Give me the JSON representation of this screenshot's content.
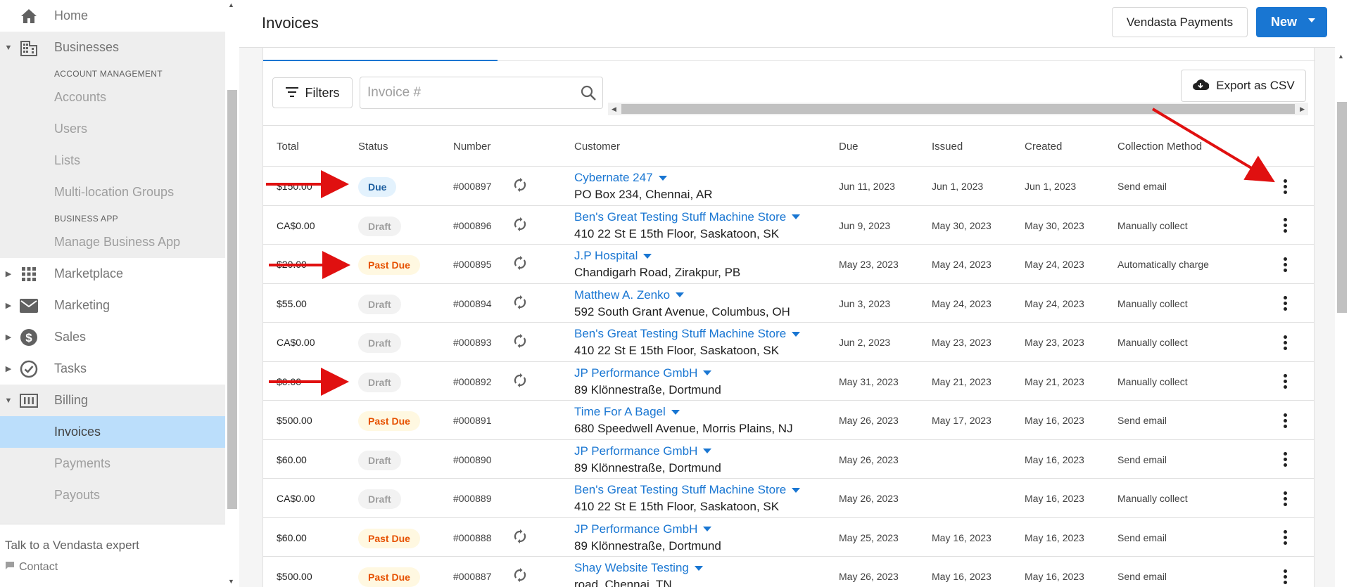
{
  "sidebar": {
    "home": "Home",
    "businesses": "Businesses",
    "account_management_header": "ACCOUNT MANAGEMENT",
    "account_items": [
      "Accounts",
      "Users",
      "Lists",
      "Multi-location Groups"
    ],
    "business_app_header": "BUSINESS APP",
    "manage_business_app": "Manage Business App",
    "marketplace": "Marketplace",
    "marketing": "Marketing",
    "sales": "Sales",
    "tasks": "Tasks",
    "billing": "Billing",
    "billing_items": [
      "Invoices",
      "Payments",
      "Payouts"
    ],
    "talk": "Talk to a Vendasta expert",
    "contact": "Contact"
  },
  "header": {
    "title": "Invoices",
    "vendasta_payments": "Vendasta Payments",
    "new": "New"
  },
  "toolbar": {
    "filters": "Filters",
    "search_placeholder": "Invoice #",
    "export": "Export as CSV"
  },
  "table": {
    "columns": [
      "Total",
      "Status",
      "Number",
      "Customer",
      "Due",
      "Issued",
      "Created",
      "Collection Method"
    ],
    "rows": [
      {
        "total": "$150.00",
        "status": "Due",
        "number": "#000897",
        "recurring": true,
        "customer": "Cybernate 247",
        "address": "PO Box 234, Chennai, AR",
        "due": "Jun 11, 2023",
        "issued": "Jun 1, 2023",
        "created": "Jun 1, 2023",
        "method": "Send email"
      },
      {
        "total": "CA$0.00",
        "status": "Draft",
        "number": "#000896",
        "recurring": true,
        "customer": "Ben's Great Testing Stuff Machine Store",
        "address": "410 22 St E 15th Floor, Saskatoon, SK",
        "due": "Jun 9, 2023",
        "issued": "May 30, 2023",
        "created": "May 30, 2023",
        "method": "Manually collect"
      },
      {
        "total": "$20.00",
        "status": "Past Due",
        "number": "#000895",
        "recurring": true,
        "customer": "J.P Hospital",
        "address": "Chandigarh Road, Zirakpur, PB",
        "due": "May 23, 2023",
        "issued": "May 24, 2023",
        "created": "May 24, 2023",
        "method": "Automatically charge"
      },
      {
        "total": "$55.00",
        "status": "Draft",
        "number": "#000894",
        "recurring": true,
        "customer": "Matthew A. Zenko",
        "address": "592 South Grant Avenue, Columbus, OH",
        "due": "Jun 3, 2023",
        "issued": "May 24, 2023",
        "created": "May 24, 2023",
        "method": "Manually collect"
      },
      {
        "total": "CA$0.00",
        "status": "Draft",
        "number": "#000893",
        "recurring": true,
        "customer": "Ben's Great Testing Stuff Machine Store",
        "address": "410 22 St E 15th Floor, Saskatoon, SK",
        "due": "Jun 2, 2023",
        "issued": "May 23, 2023",
        "created": "May 23, 2023",
        "method": "Manually collect"
      },
      {
        "total": "$0.00",
        "status": "Draft",
        "number": "#000892",
        "recurring": true,
        "customer": "JP Performance GmbH",
        "address": "89 Klönnestraße, Dortmund",
        "due": "May 31, 2023",
        "issued": "May 21, 2023",
        "created": "May 21, 2023",
        "method": "Manually collect"
      },
      {
        "total": "$500.00",
        "status": "Past Due",
        "number": "#000891",
        "recurring": false,
        "customer": "Time For A Bagel",
        "address": "680 Speedwell Avenue, Morris Plains, NJ",
        "due": "May 26, 2023",
        "issued": "May 17, 2023",
        "created": "May 16, 2023",
        "method": "Send email"
      },
      {
        "total": "$60.00",
        "status": "Draft",
        "number": "#000890",
        "recurring": false,
        "customer": "JP Performance GmbH",
        "address": "89 Klönnestraße, Dortmund",
        "due": "May 26, 2023",
        "issued": "",
        "created": "May 16, 2023",
        "method": "Send email"
      },
      {
        "total": "CA$0.00",
        "status": "Draft",
        "number": "#000889",
        "recurring": false,
        "customer": "Ben's Great Testing Stuff Machine Store",
        "address": "410 22 St E 15th Floor, Saskatoon, SK",
        "due": "May 26, 2023",
        "issued": "",
        "created": "May 16, 2023",
        "method": "Manually collect"
      },
      {
        "total": "$60.00",
        "status": "Past Due",
        "number": "#000888",
        "recurring": true,
        "customer": "JP Performance GmbH",
        "address": "89 Klönnestraße, Dortmund",
        "due": "May 25, 2023",
        "issued": "May 16, 2023",
        "created": "May 16, 2023",
        "method": "Send email"
      },
      {
        "total": "$500.00",
        "status": "Past Due",
        "number": "#000887",
        "recurring": true,
        "customer": "Shay Website Testing",
        "address": "road, Chennai, TN",
        "due": "May 26, 2023",
        "issued": "May 16, 2023",
        "created": "May 16, 2023",
        "method": "Send email"
      }
    ]
  },
  "colors": {
    "accent": "#1976d2",
    "annotation_arrow": "#e01010",
    "due_bg": "#e3f2fd",
    "past_due_bg": "#fff8e1",
    "past_due_text": "#e65100"
  }
}
